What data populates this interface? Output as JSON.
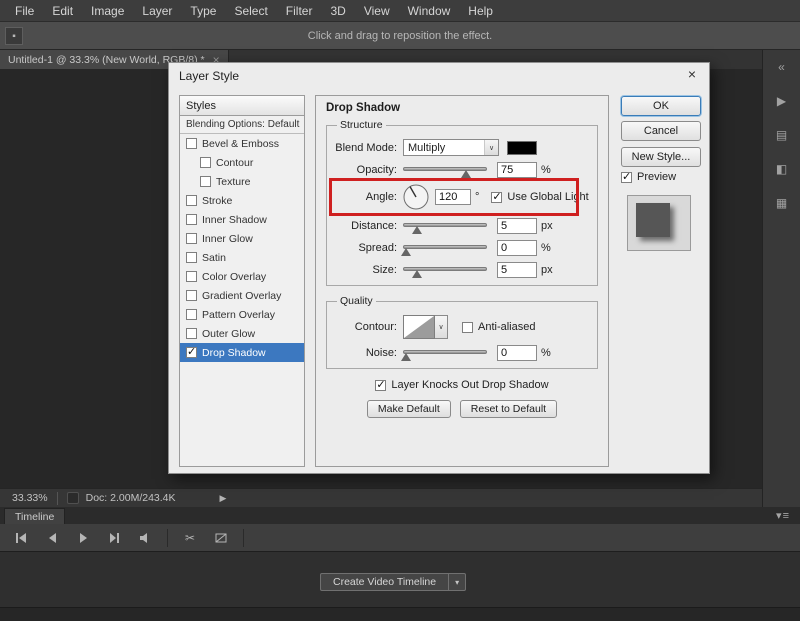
{
  "colors": {
    "selection_blue": "#3c78c0",
    "highlight_red": "#cf2020",
    "shadow_color_swatch": "#000000",
    "dialog_background": "#ececec",
    "canvas_background": "#272727"
  },
  "icons": {
    "chevron_down": "▾",
    "select_chevron": "∨",
    "close": "×",
    "scissors": "✂",
    "panel_menu": "▾≡",
    "expand_panels": "«",
    "play_arrow": "▶",
    "strip_icons": [
      "«",
      "▶",
      "▤",
      "◧",
      "▦"
    ],
    "current_tool": "▪"
  },
  "menubar": {
    "items": [
      "File",
      "Edit",
      "Image",
      "Layer",
      "Type",
      "Select",
      "Filter",
      "3D",
      "View",
      "Window",
      "Help"
    ]
  },
  "options_bar": {
    "hint": "Click and drag to reposition the effect."
  },
  "document_tab": {
    "title": "Untitled-1 @ 33.3% (New World, RGB/8) *"
  },
  "layer_style_dialog": {
    "title": "Layer Style",
    "styles_panel": {
      "header": "Styles",
      "blending_options": "Blending Options: Default",
      "items": [
        {
          "label": "Bevel & Emboss",
          "checked": false,
          "indent": false,
          "selected": false
        },
        {
          "label": "Contour",
          "checked": false,
          "indent": true,
          "selected": false
        },
        {
          "label": "Texture",
          "checked": false,
          "indent": true,
          "selected": false
        },
        {
          "label": "Stroke",
          "checked": false,
          "indent": false,
          "selected": false
        },
        {
          "label": "Inner Shadow",
          "checked": false,
          "indent": false,
          "selected": false
        },
        {
          "label": "Inner Glow",
          "checked": false,
          "indent": false,
          "selected": false
        },
        {
          "label": "Satin",
          "checked": false,
          "indent": false,
          "selected": false
        },
        {
          "label": "Color Overlay",
          "checked": false,
          "indent": false,
          "selected": false
        },
        {
          "label": "Gradient Overlay",
          "checked": false,
          "indent": false,
          "selected": false
        },
        {
          "label": "Pattern Overlay",
          "checked": false,
          "indent": false,
          "selected": false
        },
        {
          "label": "Outer Glow",
          "checked": false,
          "indent": false,
          "selected": false
        },
        {
          "label": "Drop Shadow",
          "checked": true,
          "indent": false,
          "selected": true
        }
      ]
    },
    "drop_shadow": {
      "section_title": "Drop Shadow",
      "structure": {
        "legend": "Structure",
        "blend_mode": {
          "label": "Blend Mode:",
          "value": "Multiply"
        },
        "opacity": {
          "label": "Opacity:",
          "value": "75",
          "unit": "%"
        },
        "angle": {
          "label": "Angle:",
          "value": "120",
          "unit": "°",
          "use_global_light": "Use Global Light",
          "use_global_light_checked": true
        },
        "distance": {
          "label": "Distance:",
          "value": "5",
          "unit": "px"
        },
        "spread": {
          "label": "Spread:",
          "value": "0",
          "unit": "%"
        },
        "size": {
          "label": "Size:",
          "value": "5",
          "unit": "px"
        }
      },
      "quality": {
        "legend": "Quality",
        "contour_label": "Contour:",
        "anti_aliased": "Anti-aliased",
        "anti_aliased_checked": false,
        "noise": {
          "label": "Noise:",
          "value": "0",
          "unit": "%"
        }
      },
      "knockout": {
        "label": "Layer Knocks Out Drop Shadow",
        "checked": true
      },
      "buttons": {
        "make_default": "Make Default",
        "reset_to_default": "Reset to Default"
      }
    },
    "actions": {
      "ok": "OK",
      "cancel": "Cancel",
      "new_style": "New Style...",
      "preview_label": "Preview",
      "preview_checked": true
    }
  },
  "status_bar": {
    "zoom": "33.33%",
    "doc_info": "Doc: 2.00M/243.4K"
  },
  "timeline": {
    "tab_label": "Timeline",
    "create_button": "Create Video Timeline"
  }
}
